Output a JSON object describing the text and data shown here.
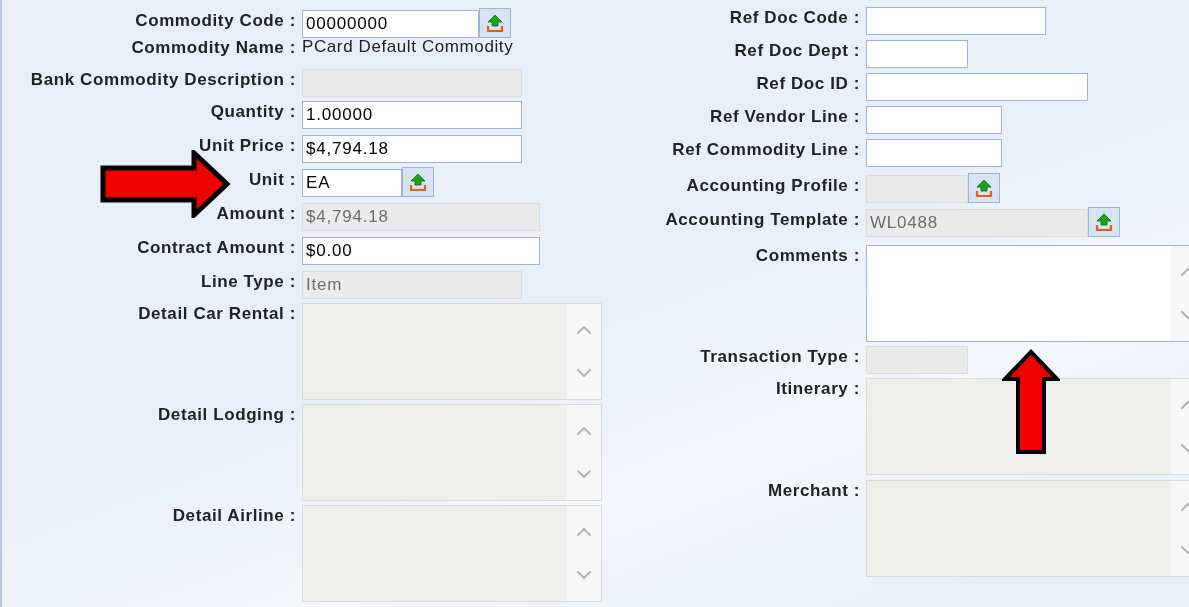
{
  "left_fields": [
    {
      "label": "Commodity Code :",
      "kind": "input",
      "value": "00000000",
      "disabled": false,
      "lookup": true
    },
    {
      "label": "Commodity Name :",
      "kind": "static",
      "value": "PCard Default Commodity"
    },
    {
      "label": "Bank Commodity Description :",
      "kind": "input",
      "disabled": true,
      "lookup": false
    },
    {
      "label": "Quantity :",
      "kind": "input",
      "value": "1.00000",
      "disabled": false,
      "lookup": false
    },
    {
      "label": "Unit Price :",
      "kind": "input",
      "value": "$4,794.18",
      "disabled": false,
      "lookup": false
    },
    {
      "label": "Unit :",
      "kind": "input",
      "value": "EA",
      "disabled": false,
      "lookup": true
    },
    {
      "label": "Amount :",
      "kind": "input",
      "value": "$4,794.18",
      "disabled": true,
      "lookup": false
    },
    {
      "label": "Contract Amount :",
      "kind": "input",
      "value": "$0.00",
      "disabled": false,
      "lookup": false
    },
    {
      "label": "Line Type :",
      "kind": "input",
      "value": "Item",
      "disabled": true,
      "lookup": false
    },
    {
      "label": "Detail Car Rental :",
      "kind": "textarea",
      "disabled": true
    },
    {
      "label": "Detail Lodging :",
      "kind": "textarea",
      "disabled": true
    },
    {
      "label": "Detail Airline :",
      "kind": "textarea",
      "disabled": true
    }
  ],
  "right_fields": [
    {
      "label": "Ref Doc Code :",
      "kind": "input",
      "disabled": false,
      "lookup": false
    },
    {
      "label": "Ref Doc Dept :",
      "kind": "input",
      "disabled": false,
      "lookup": false
    },
    {
      "label": "Ref Doc ID :",
      "kind": "input",
      "disabled": false,
      "lookup": false
    },
    {
      "label": "Ref Vendor Line :",
      "kind": "input",
      "disabled": false,
      "lookup": false
    },
    {
      "label": "Ref Commodity Line :",
      "kind": "input",
      "disabled": false,
      "lookup": false
    },
    {
      "label": "Accounting Profile :",
      "kind": "input",
      "disabled": true,
      "lookup": true
    },
    {
      "label": "Accounting Template :",
      "kind": "input",
      "value": "WL0488",
      "disabled": true,
      "lookup": true
    },
    {
      "label": "Comments :",
      "kind": "textarea",
      "disabled": false
    },
    {
      "label": "Transaction Type :",
      "kind": "input",
      "disabled": true,
      "lookup": false
    },
    {
      "label": "Itinerary :",
      "kind": "textarea",
      "disabled": true
    },
    {
      "label": "Merchant :",
      "kind": "textarea",
      "disabled": true
    }
  ]
}
